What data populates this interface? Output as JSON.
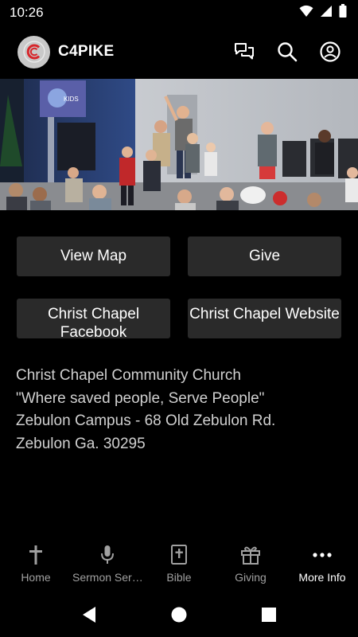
{
  "status_bar": {
    "time": "10:26"
  },
  "app_bar": {
    "title": "C4PIKE"
  },
  "buttons": {
    "view_map": "View Map",
    "give": "Give",
    "facebook": "Christ Chapel Facebook",
    "website": "Christ Chapel Website"
  },
  "info": {
    "line1": "Christ Chapel Community Church",
    "line2": "\"Where saved people, Serve People\"",
    "line3": "Zebulon Campus - 68 Old Zebulon Rd.",
    "line4": "Zebulon Ga. 30295"
  },
  "bottom_nav": {
    "items": [
      {
        "label": "Home",
        "icon": "cross-icon"
      },
      {
        "label": "Sermon Ser…",
        "icon": "microphone-icon"
      },
      {
        "label": "Bible",
        "icon": "bible-icon"
      },
      {
        "label": "Giving",
        "icon": "gift-icon"
      },
      {
        "label": "More Info",
        "icon": "more-icon"
      }
    ],
    "active_index": 4
  },
  "colors": {
    "background": "#000000",
    "button": "#2a2a2a",
    "text_muted": "#d0d0d0",
    "nav_inactive": "#a0a0a0",
    "logo_red": "#d7262b"
  }
}
